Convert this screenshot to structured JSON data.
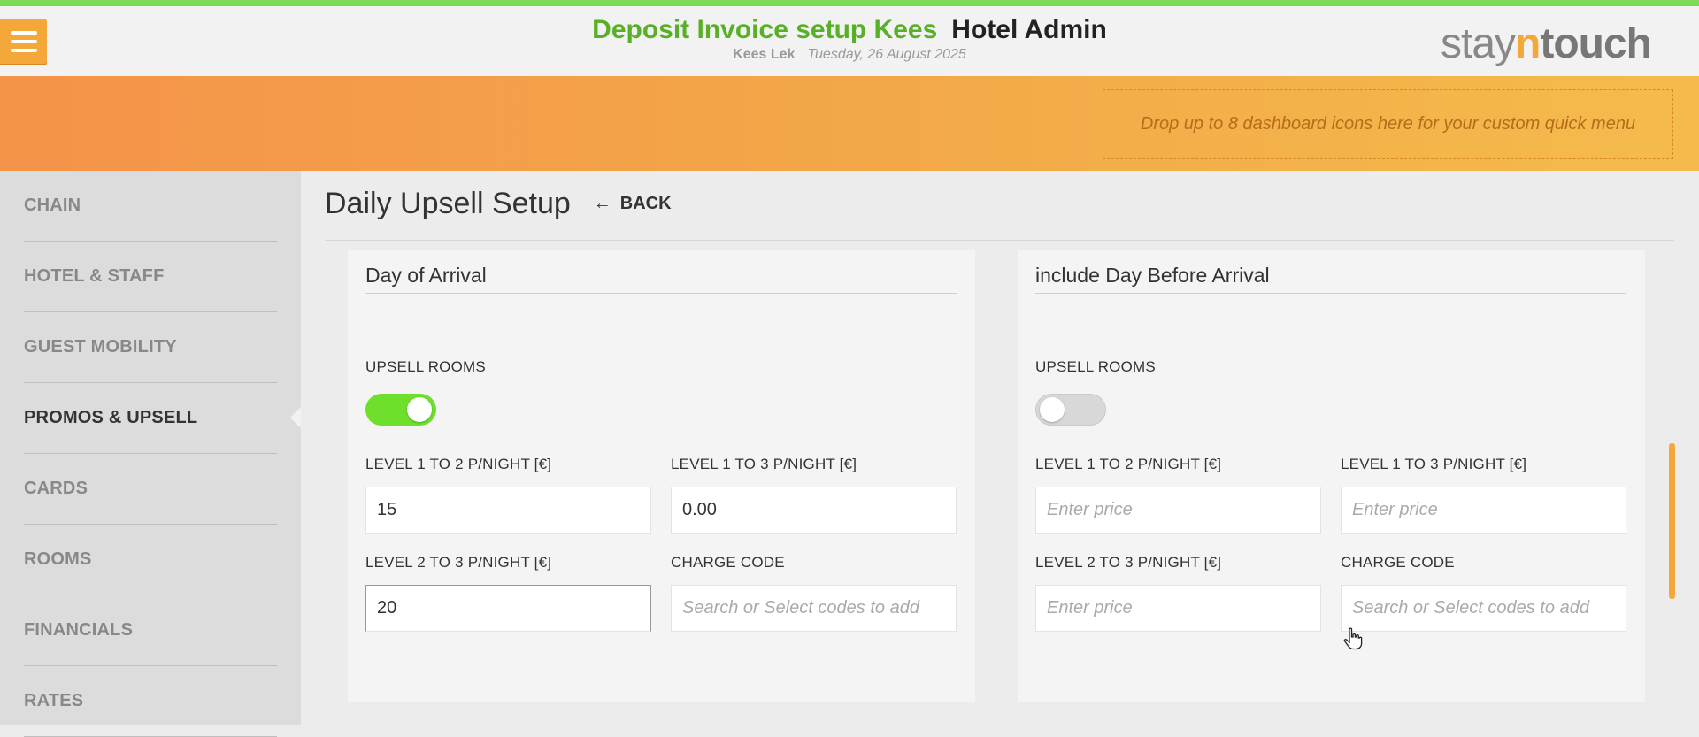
{
  "header": {
    "app_title": "Deposit Invoice setup Kees",
    "section_title": "Hotel Admin",
    "user_name": "Kees Lek",
    "date": "Tuesday, 26 August 2025",
    "logo_part1": "stay",
    "logo_part2": "n",
    "logo_part3": "touch",
    "menu_icon": "hamburger-icon"
  },
  "quick_menu": {
    "placeholder": "Drop up to 8 dashboard icons here for your custom quick menu"
  },
  "sidebar": {
    "items": [
      {
        "label": "CHAIN"
      },
      {
        "label": "HOTEL & STAFF"
      },
      {
        "label": "GUEST MOBILITY"
      },
      {
        "label": "PROMOS & UPSELL",
        "active": true
      },
      {
        "label": "CARDS"
      },
      {
        "label": "ROOMS"
      },
      {
        "label": "FINANCIALS"
      },
      {
        "label": "RATES"
      }
    ]
  },
  "page": {
    "title": "Daily Upsell Setup",
    "back_label": "BACK"
  },
  "panels": {
    "day_of_arrival": {
      "title": "Day of Arrival",
      "upsell_rooms_label": "UPSELL ROOMS",
      "upsell_rooms_on": true,
      "level_1_2_label": "LEVEL 1 TO 2 P/NIGHT [€]",
      "level_1_2_value": "15",
      "level_1_3_label": "LEVEL 1 TO 3 P/NIGHT [€]",
      "level_1_3_value": "0.00",
      "level_2_3_label": "LEVEL 2 TO 3 P/NIGHT [€]",
      "level_2_3_value": "20",
      "charge_code_label": "CHARGE CODE",
      "charge_code_placeholder": "Search or Select codes to add"
    },
    "day_before_arrival": {
      "title": "include Day Before Arrival",
      "upsell_rooms_label": "UPSELL ROOMS",
      "upsell_rooms_on": false,
      "level_1_2_label": "LEVEL 1 TO 2 P/NIGHT [€]",
      "level_1_2_placeholder": "Enter price",
      "level_1_3_label": "LEVEL 1 TO 3 P/NIGHT [€]",
      "level_1_3_placeholder": "Enter price",
      "level_2_3_label": "LEVEL 2 TO 3 P/NIGHT [€]",
      "level_2_3_placeholder": "Enter price",
      "charge_code_label": "CHARGE CODE",
      "charge_code_placeholder": "Search or Select codes to add"
    }
  },
  "colors": {
    "accent_green": "#59b027",
    "toggle_on": "#6ee02b",
    "brand_orange": "#f4a83a",
    "top_stripe": "#7ed957"
  }
}
